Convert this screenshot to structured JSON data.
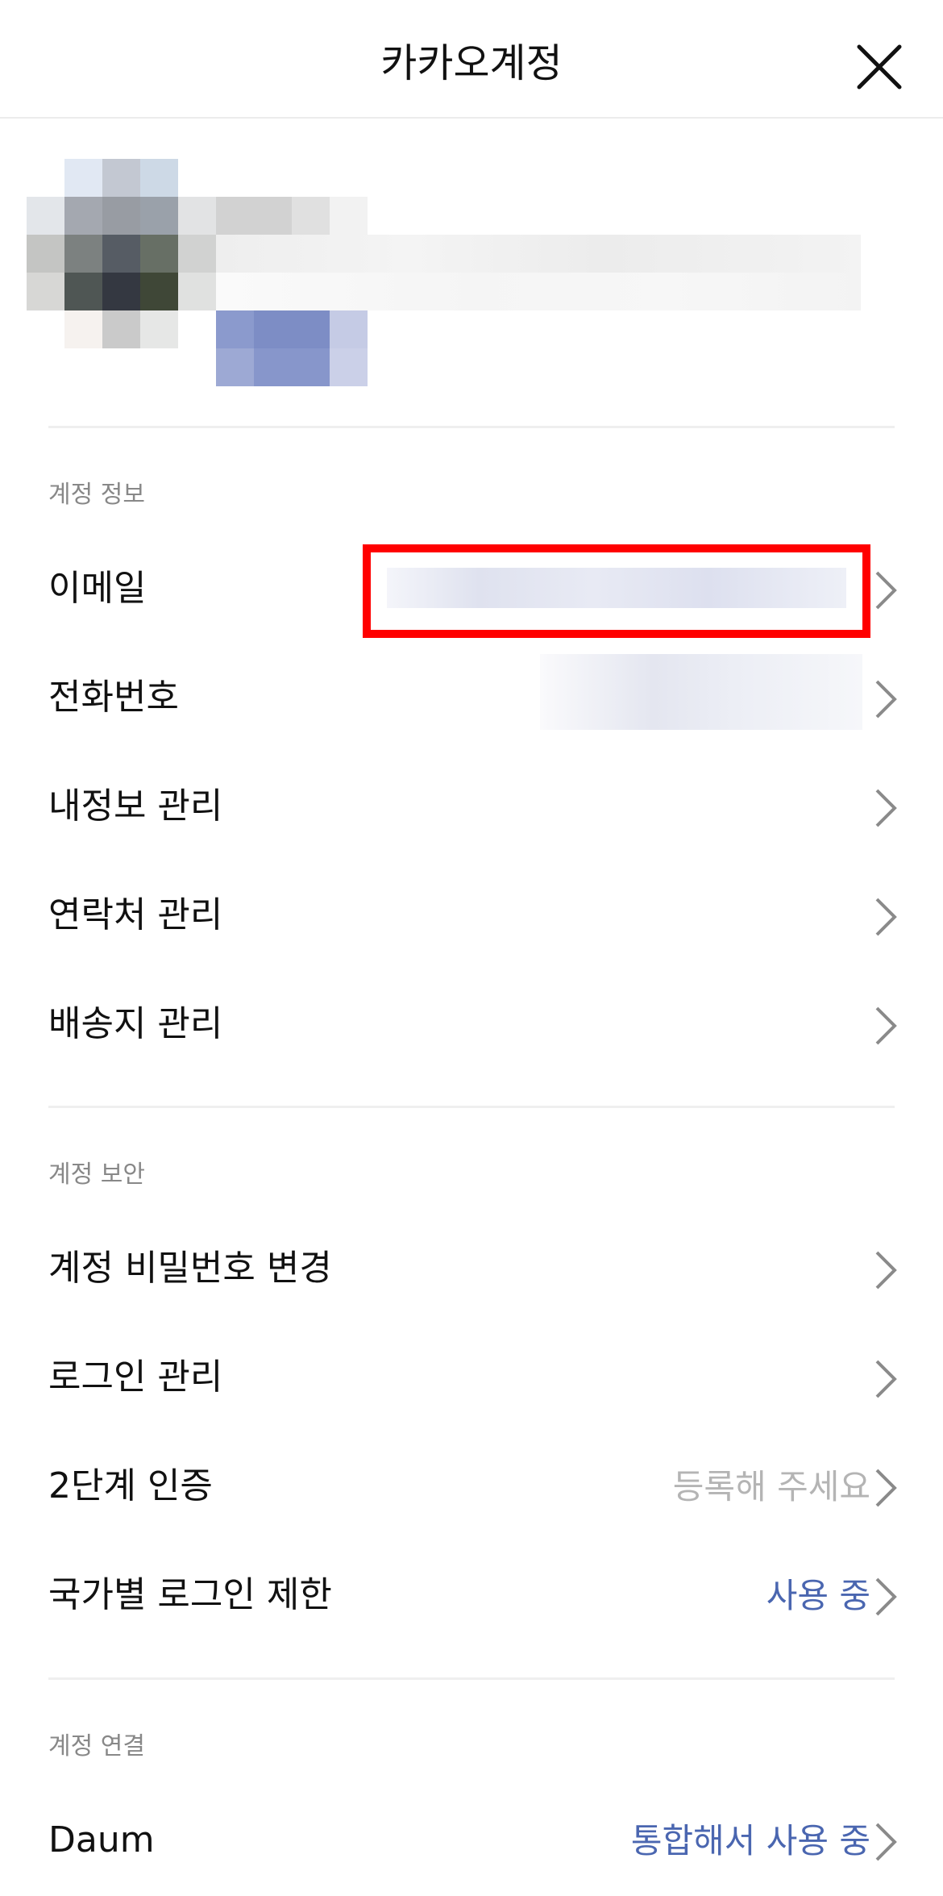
{
  "header": {
    "title": "카카오계정"
  },
  "sections": [
    {
      "label": "계정 정보",
      "items": [
        {
          "label": "이메일",
          "value": ""
        },
        {
          "label": "전화번호",
          "value": ""
        },
        {
          "label": "내정보 관리",
          "value": ""
        },
        {
          "label": "연락처 관리",
          "value": ""
        },
        {
          "label": "배송지 관리",
          "value": ""
        }
      ]
    },
    {
      "label": "계정 보안",
      "items": [
        {
          "label": "계정 비밀번호 변경",
          "value": ""
        },
        {
          "label": "로그인 관리",
          "value": ""
        },
        {
          "label": "2단계 인증",
          "value": "등록해 주세요"
        },
        {
          "label": "국가별 로그인 제한",
          "value": "사용 중"
        }
      ]
    },
    {
      "label": "계정 연결",
      "items": [
        {
          "label": "Daum",
          "value": "통합해서 사용 중"
        }
      ]
    }
  ],
  "colors": {
    "accent_blue": "#4a66b0",
    "highlight_red": "#ff0000",
    "muted_grey": "#b4b4b4"
  },
  "icons": {
    "close": "close-icon",
    "chevron": "chevron-right-icon"
  }
}
